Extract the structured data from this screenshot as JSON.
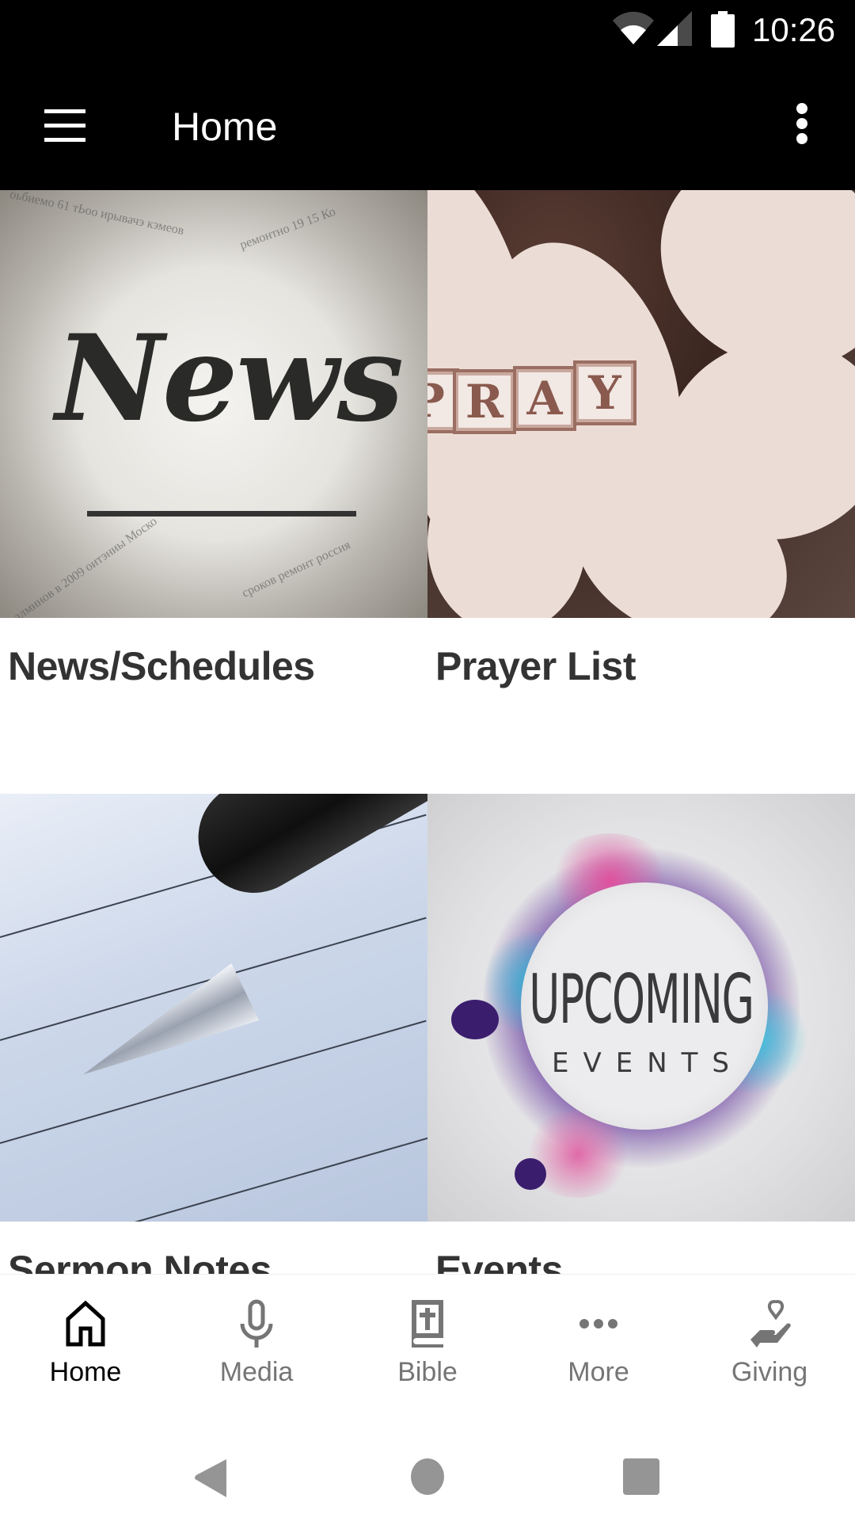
{
  "status_bar": {
    "time": "10:26",
    "icons": [
      "wifi-icon",
      "cell-signal-icon",
      "battery-icon"
    ]
  },
  "app_bar": {
    "title": "Home",
    "menu_icon": "hamburger-menu-icon",
    "overflow_icon": "more-vert-icon"
  },
  "tiles": [
    {
      "label": "News/Schedules",
      "image": "newspaper 'News' photo",
      "image_text": "News"
    },
    {
      "label": "Prayer List",
      "image": "hands holding 'PRAY' blocks",
      "image_text": "PRAY"
    },
    {
      "label": "Sermon Notes",
      "image": "pen on lined paper"
    },
    {
      "label": "Events",
      "image": "'Upcoming Events' paint splash",
      "image_text_1": "UPCOMING",
      "image_text_2": "EVENTS"
    }
  ],
  "bottom_nav": {
    "active": "Home",
    "items": [
      {
        "label": "Home",
        "icon": "home-icon"
      },
      {
        "label": "Media",
        "icon": "microphone-icon"
      },
      {
        "label": "Bible",
        "icon": "bible-icon"
      },
      {
        "label": "More",
        "icon": "more-horiz-icon"
      },
      {
        "label": "Giving",
        "icon": "giving-hand-heart-icon"
      }
    ]
  },
  "colors": {
    "app_bar": "#000000",
    "nav_active": "#000000",
    "nav_inactive": "#757575",
    "tile_label": "#333333"
  }
}
